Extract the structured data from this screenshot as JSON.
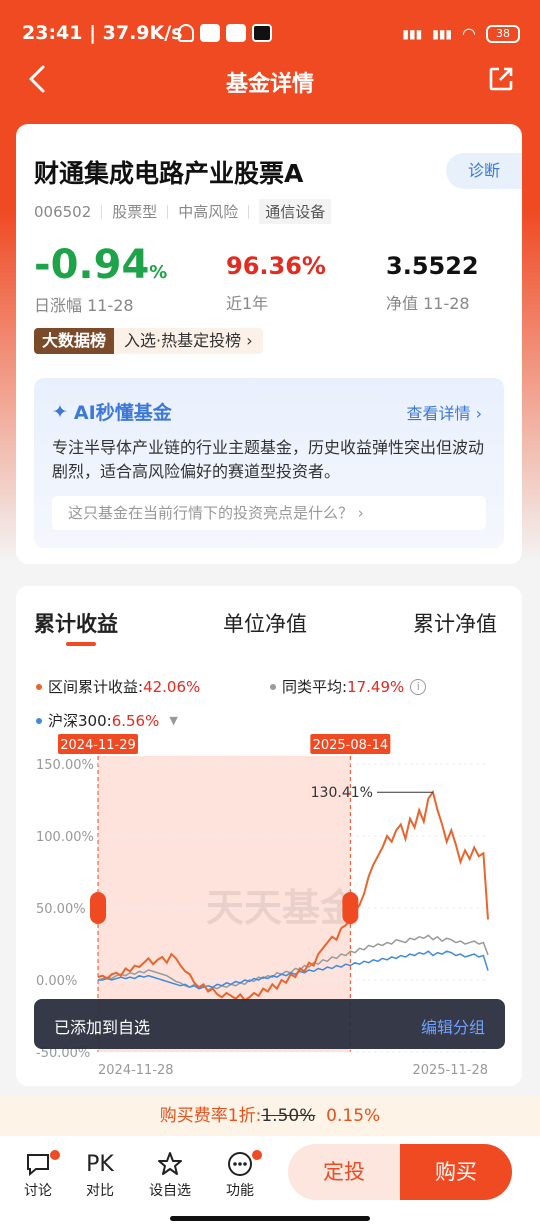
{
  "status": {
    "time": "23:41 | 37.9K/s",
    "battery": "38"
  },
  "nav": {
    "title": "基金详情"
  },
  "fund": {
    "name": "财通集成电路产业股票A",
    "diagnose": "诊断",
    "code": "006502",
    "type": "股票型",
    "risk": "中高风险",
    "sector": "通信设备",
    "daily_change": "-0.94",
    "daily_change_unit": "%",
    "daily_label": "日涨幅 11-28",
    "year_return": "96.36%",
    "year_label": "近1年",
    "nav_value": "3.5522",
    "nav_label": "净值 11-28",
    "rank_tag": "大数据榜",
    "rank_text": "入选·热基定投榜"
  },
  "ai": {
    "title": "AI秒懂基金",
    "link": "查看详情",
    "desc": "专注半导体产业链的行业主题基金，历史收益弹性突出但波动剧烈，适合高风险偏好的赛道型投资者。",
    "question": "这只基金在当前行情下的投资亮点是什么？"
  },
  "chart_tabs": [
    "累计收益",
    "单位净值",
    "累计净值"
  ],
  "legend": {
    "fund": {
      "label": "区间累计收益:",
      "value": "42.06%"
    },
    "peer": {
      "label": "同类平均:",
      "value": "17.49%"
    },
    "index": {
      "label": "沪深300:",
      "value": "6.56%"
    }
  },
  "colors": {
    "fund": "#e8652d",
    "peer": "#9a9a9a",
    "index": "#3f8ae0",
    "accent": "#f04a23",
    "down": "#1fa34a",
    "up": "#e32b20"
  },
  "chart_data": {
    "type": "line",
    "ylim": [
      -50,
      150
    ],
    "ytick_labels": [
      "150.00%",
      "100.00%",
      "50.00%",
      "0.00%",
      "-50.00%"
    ],
    "yticks": [
      150,
      100,
      50,
      0,
      -50
    ],
    "x_labels": [
      "2024-11-28",
      "2025-11-28"
    ],
    "range_labels": [
      "2024-11-29",
      "2025-08-14"
    ],
    "range_index": [
      0,
      55
    ],
    "peak_label": "130.41%",
    "peak_value": 130.41,
    "watermark": "天天基金",
    "series": [
      {
        "values": [
          2,
          3,
          1,
          4,
          5,
          3,
          8,
          6,
          10,
          9,
          12,
          15,
          11,
          14,
          16,
          12,
          18,
          15,
          10,
          6,
          4,
          -2,
          -5,
          -3,
          -8,
          -6,
          -10,
          -12,
          -9,
          -11,
          -13,
          -10,
          -14,
          -12,
          -9,
          -11,
          -6,
          -8,
          -3,
          -6,
          0,
          -2,
          4,
          2,
          8,
          6,
          12,
          10,
          18,
          22,
          26,
          30,
          28,
          36,
          38,
          42,
          48,
          52,
          60,
          72,
          80,
          86,
          92,
          100,
          96,
          104,
          108,
          98,
          112,
          106,
          118,
          110,
          126,
          130.41,
          118,
          108,
          96,
          104,
          94,
          82,
          90,
          84,
          92,
          86,
          88,
          42.06
        ]
      },
      {
        "values": [
          0,
          1,
          2,
          1,
          3,
          4,
          3,
          5,
          4,
          6,
          5,
          7,
          6,
          5,
          4,
          3,
          1,
          -1,
          -2,
          -4,
          -5,
          -3,
          -6,
          -4,
          -7,
          -5,
          -6,
          -4,
          -5,
          -3,
          -4,
          -2,
          -3,
          0,
          -1,
          2,
          1,
          3,
          2,
          5,
          4,
          6,
          5,
          8,
          7,
          10,
          9,
          12,
          11,
          14,
          13,
          16,
          15,
          18,
          17,
          20,
          19,
          22,
          21,
          24,
          23,
          25,
          24,
          26,
          25,
          28,
          27,
          26,
          29,
          28,
          30,
          29,
          31,
          28,
          30,
          27,
          29,
          28,
          26,
          27,
          25,
          26,
          27,
          25,
          26,
          17.49
        ]
      },
      {
        "values": [
          0,
          0,
          1,
          0,
          1,
          2,
          1,
          2,
          1,
          3,
          2,
          3,
          2,
          1,
          0,
          -1,
          -2,
          -3,
          -4,
          -3,
          -5,
          -4,
          -6,
          -5,
          -4,
          -5,
          -3,
          -4,
          -2,
          -3,
          -1,
          -2,
          0,
          -1,
          1,
          0,
          2,
          1,
          3,
          2,
          4,
          3,
          5,
          4,
          6,
          5,
          7,
          6,
          8,
          7,
          9,
          8,
          10,
          9,
          11,
          10,
          12,
          11,
          13,
          12,
          14,
          13,
          15,
          14,
          16,
          15,
          17,
          16,
          18,
          17,
          19,
          18,
          20,
          17,
          19,
          18,
          20,
          19,
          17,
          18,
          16,
          17,
          18,
          16,
          17,
          6.56
        ]
      }
    ]
  },
  "toast": {
    "message": "已添加到自选",
    "action": "编辑分组"
  },
  "promo": {
    "prefix": "购买费率1折:",
    "old": "1.50%",
    "new": "0.15%"
  },
  "bottom": {
    "items": [
      {
        "label": "讨论",
        "icon": "chat-icon"
      },
      {
        "label": "对比",
        "icon": "pk-icon",
        "icon_text": "PK"
      },
      {
        "label": "设自选",
        "icon": "star-icon"
      },
      {
        "label": "功能",
        "icon": "more-icon"
      }
    ],
    "dingtou": "定投",
    "buy": "购买"
  }
}
